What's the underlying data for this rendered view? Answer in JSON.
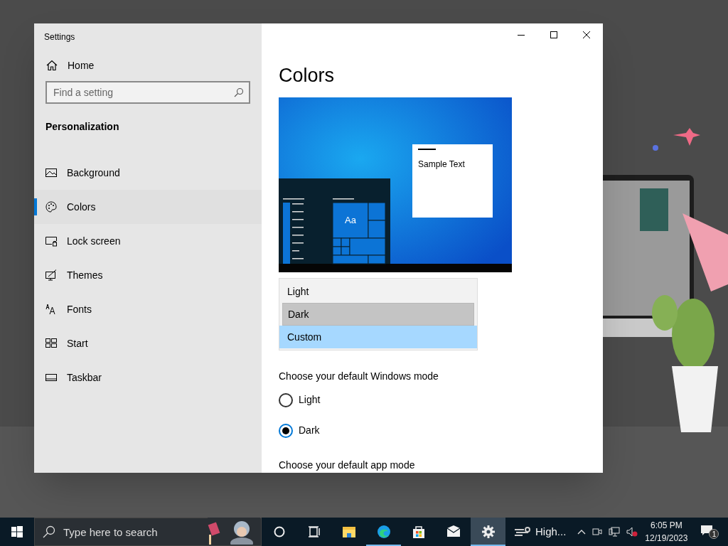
{
  "window": {
    "title": "Settings"
  },
  "sidebar": {
    "home": "Home",
    "search": {
      "placeholder": "Find a setting"
    },
    "section": "Personalization",
    "items": [
      {
        "label": "Background",
        "selected": false
      },
      {
        "label": "Colors",
        "selected": true
      },
      {
        "label": "Lock screen",
        "selected": false
      },
      {
        "label": "Themes",
        "selected": false
      },
      {
        "label": "Fonts",
        "selected": false
      },
      {
        "label": "Start",
        "selected": false
      },
      {
        "label": "Taskbar",
        "selected": false
      }
    ]
  },
  "page": {
    "title": "Colors",
    "preview": {
      "tile_text": "Aa",
      "sample_text": "Sample Text"
    },
    "dropdown_options": [
      {
        "label": "Light",
        "hovered": false,
        "selected": false
      },
      {
        "label": "Dark",
        "hovered": true,
        "selected": false
      },
      {
        "label": "Custom",
        "hovered": false,
        "selected": true
      }
    ],
    "windows_mode": {
      "label": "Choose your default Windows mode",
      "options": [
        {
          "label": "Light",
          "checked": false
        },
        {
          "label": "Dark",
          "checked": true
        }
      ]
    },
    "app_mode_label": "Choose your default app mode"
  },
  "taskbar": {
    "search_placeholder": "Type here to search",
    "apps": [
      {
        "kind": "cortana",
        "active": false
      },
      {
        "kind": "taskview",
        "active": false
      },
      {
        "kind": "explorer",
        "active": false
      },
      {
        "kind": "edge",
        "active": true
      },
      {
        "kind": "store",
        "active": false
      },
      {
        "kind": "mail",
        "active": false
      },
      {
        "kind": "settings",
        "active": true
      }
    ],
    "weather": "High...",
    "time": "6:05 PM",
    "date": "12/19/2023",
    "notification_count": "1"
  }
}
